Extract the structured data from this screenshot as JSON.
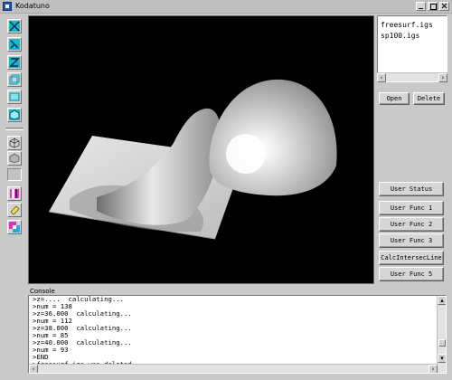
{
  "window": {
    "title": "Kodatuno"
  },
  "toolbar": {
    "buttons": [
      {
        "icon": "view-front-icon"
      },
      {
        "icon": "view-side-icon"
      },
      {
        "icon": "view-top-icon"
      },
      {
        "icon": "view-iso-left-icon"
      },
      {
        "icon": "view-iso-right-icon"
      },
      {
        "icon": "view-fit-icon"
      },
      {
        "icon": "wireframe-icon"
      },
      {
        "icon": "shading-icon"
      },
      {
        "icon": "select-icon"
      },
      {
        "icon": "eraser-icon"
      },
      {
        "icon": "color-icon"
      }
    ]
  },
  "files": {
    "items": [
      "freesurf.igs",
      "sp100.igs"
    ],
    "open_label": "Open",
    "delete_label": "Delete"
  },
  "panel": {
    "user_status": "User Status",
    "func1": "User Func 1",
    "func2": "User Func 2",
    "func3": "User Func 3",
    "calc": "CalcIntersecLine",
    "func5": "User Func 5"
  },
  "console": {
    "label": "Console",
    "lines": [
      ">z=....  calculating...",
      ">num = 138",
      ">z=36.000  calculating...",
      ">num = 112",
      ">z=38.000  calculating...",
      ">num = 85",
      ">z=40.000  calculating...",
      ">num = 93",
      ">END",
      ">freesurf.igs was deleted."
    ]
  },
  "colors": {
    "viewport_bg": "#000000",
    "window_bg": "#c9c9c9",
    "accent": "#2a56b5"
  }
}
